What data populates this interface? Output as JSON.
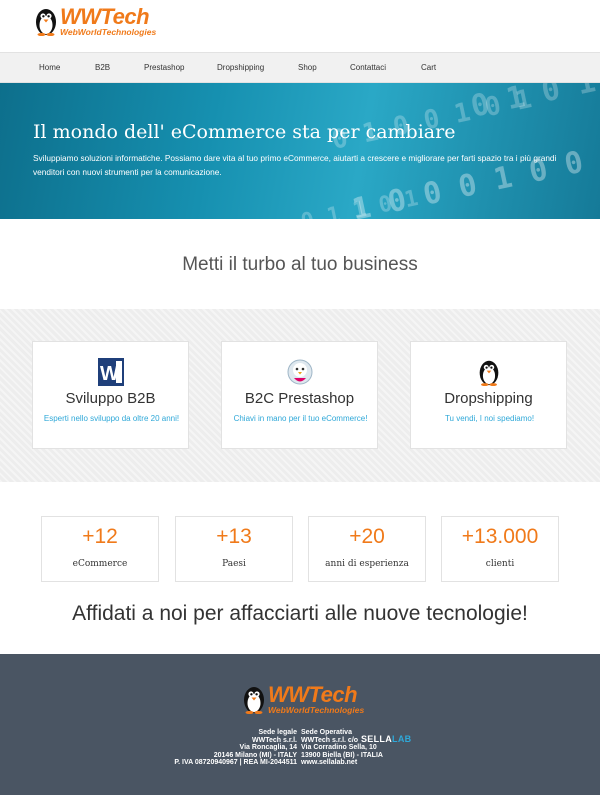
{
  "brand": {
    "name": "WWTech",
    "subtitle": "WebWorldTechnologies",
    "accent": "#f07a1a"
  },
  "nav": {
    "items": [
      "Home",
      "B2B",
      "Prestashop",
      "Dropshipping",
      "Shop",
      "Contattaci",
      "Cart"
    ]
  },
  "hero": {
    "title": "Il mondo dell' eCommerce sta per cambiare",
    "text": "Sviluppiamo soluzioni informatiche. Possiamo dare vita al tuo primo eCommerce, aiutarti a crescere e migliorare per farti spazio tra i più grandi venditori con nuovi strumenti per la comunicazione.",
    "background_digits": [
      "0 1 0 1",
      "0 1 0 0 1 0 1",
      "1 0 0 0 1 0 0 1",
      "0 1 1 0 1"
    ]
  },
  "tagline": "Metti il turbo al tuo business",
  "services": [
    {
      "title": "Sviluppo B2B",
      "subtitle": "Esperti nello sviluppo da oltre 20 anni!",
      "icon": "word-doc-icon"
    },
    {
      "title": "B2C Prestashop",
      "subtitle": "Chiavi in mano per il tuo eCommerce!",
      "icon": "prestashop-icon"
    },
    {
      "title": "Dropshipping",
      "subtitle": "Tu vendi, I noi spediamo!",
      "icon": "penguin-icon"
    }
  ],
  "stats": [
    {
      "value": "+12",
      "label": "eCommerce"
    },
    {
      "value": "+13",
      "label": "Paesi"
    },
    {
      "value": "+20",
      "label": "anni di esperienza"
    },
    {
      "value": "+13.000",
      "label": "clienti"
    }
  ],
  "slogan": "Affidati a noi per affacciarti alle nuove tecnologie!",
  "footer": {
    "legal": {
      "title": "Sede legale",
      "lines": [
        "WWTech s.r.l.",
        "Via Roncaglia, 14",
        "20146 Milano (MI) - ITALY",
        "P. IVA 08720940967 | REA MI-2044511"
      ]
    },
    "operational": {
      "title": "Sede Operativa",
      "lines": [
        "WWTech s.r.l. c/o",
        "Via Corradino Sella, 10",
        "13900 Biella (BI) - ITALIA",
        "www.sellalab.net"
      ]
    },
    "partner_logo": {
      "part1": "SELLA",
      "part2": "LAB"
    }
  }
}
